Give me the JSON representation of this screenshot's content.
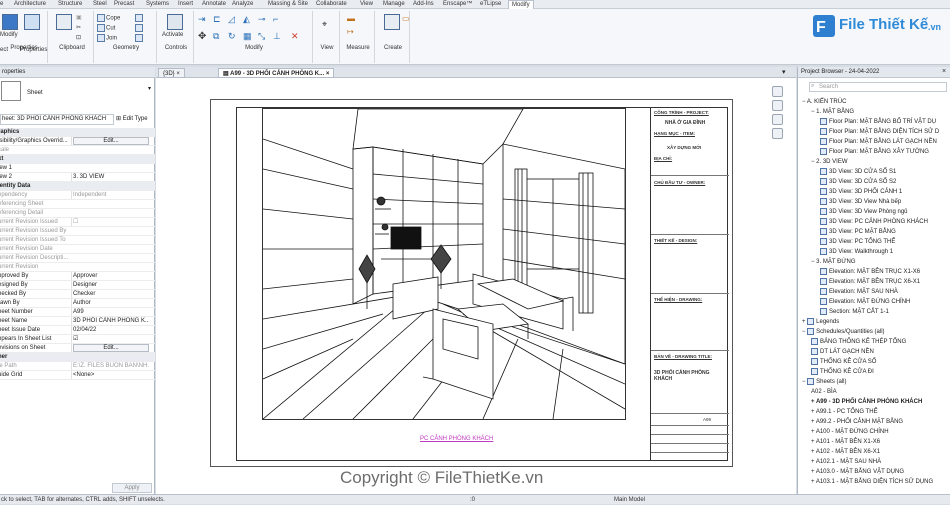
{
  "ribbon": {
    "tabs": [
      "e",
      "Architecture",
      "Structure",
      "Steel",
      "Precast",
      "Systems",
      "Insert",
      "Annotate",
      "Analyze",
      "Massing & Site",
      "Collaborate",
      "View",
      "Manage",
      "Add-Ins",
      "Enscape™",
      "eTLipse",
      "Modify"
    ],
    "active_tab": "Modify",
    "buttons": {
      "modify": "Modify",
      "select": "ect",
      "properties": "Properties",
      "cope": "Cope",
      "cut": "Cut",
      "join": "Join",
      "activate": "Activate"
    },
    "panels": [
      "Properties",
      "Clipboard",
      "Geometry",
      "Controls",
      "Modify",
      "View",
      "Measure",
      "Create"
    ]
  },
  "logo": {
    "text": "File Thiết Kế",
    "suffix": ".vn"
  },
  "document_tabs": [
    {
      "label": "{3D}",
      "active": false
    },
    {
      "label": "A99 - 3D PHỐI CẢNH PHÒNG K...",
      "active": true
    }
  ],
  "properties": {
    "title": "roperties",
    "type_name": "Sheet",
    "selector": "heet: 3D PHỐI CẢNH PHÒNG KHÁCH",
    "edit_type": "Edit Type",
    "rows": [
      {
        "k": "raphics",
        "v": "",
        "group": true
      },
      {
        "k": "isibility/Graphics Overrid...",
        "v": "Edit...",
        "btn": true
      },
      {
        "k": "cale",
        "v": "",
        "dim": true
      },
      {
        "k": "xt",
        "v": "",
        "group": true
      },
      {
        "k": "iew 1",
        "v": ""
      },
      {
        "k": "iew 2",
        "v": "3. 3D VIEW"
      },
      {
        "k": "lentity Data",
        "v": "",
        "group": true
      },
      {
        "k": "ependency",
        "v": "Independent",
        "dim": true
      },
      {
        "k": "eferencing Sheet",
        "v": "",
        "dim": true
      },
      {
        "k": "eferencing Detail",
        "v": "",
        "dim": true
      },
      {
        "k": "urrent Revision Issued",
        "v": "☐",
        "dim": true
      },
      {
        "k": "urrent Revision Issued By",
        "v": "",
        "dim": true
      },
      {
        "k": "urrent Revision Issued To",
        "v": "",
        "dim": true
      },
      {
        "k": "urrent Revision Date",
        "v": "",
        "dim": true
      },
      {
        "k": "urrent Revision Descripti...",
        "v": "",
        "dim": true
      },
      {
        "k": "urrent Revision",
        "v": "",
        "dim": true
      },
      {
        "k": "pproved By",
        "v": "Approver"
      },
      {
        "k": "esigned By",
        "v": "Designer"
      },
      {
        "k": "hecked By",
        "v": "Checker"
      },
      {
        "k": "rawn By",
        "v": "Author"
      },
      {
        "k": "heet Number",
        "v": "A99"
      },
      {
        "k": "heet Name",
        "v": "3D PHỐI CẢNH PHÒNG K..."
      },
      {
        "k": "heet Issue Date",
        "v": "02/04/22"
      },
      {
        "k": "ppears In Sheet List",
        "v": "☑"
      },
      {
        "k": "evisions on Sheet",
        "v": "Edit...",
        "btn": true
      },
      {
        "k": "her",
        "v": "",
        "group": true
      },
      {
        "k": "le Path",
        "v": "E:\\Z. FILES BUON BAN\\NH...",
        "dim": true
      },
      {
        "k": "uide Grid",
        "v": "<None>"
      }
    ],
    "apply": "Apply"
  },
  "titleblock": {
    "project_label": "CÔNG TRÌNH - PROJECT:",
    "project": "NHÀ Ở GIA ĐÌNH",
    "item_label": "HẠNG MỤC - ITEM:",
    "item": "XÂY DỰNG MỚI",
    "address_label": "ĐỊA CHỈ:",
    "owner_label": "CHỦ ĐẦU TƯ - OWNER:",
    "design_label": "THIẾT KẾ - DESIGN:",
    "drawing_label": "THỂ HIỆN - DRAWING:",
    "title_label": "BẢN VẼ - DRAWING TITLE:",
    "title": "3D PHỐI CẢNH PHÒNG KHÁCH",
    "sheet_no": "A99"
  },
  "viewport_label": "PC CẢNH PHÒNG KHÁCH",
  "project_browser": {
    "title": "Project Browser - 24-04-2022",
    "search_placeholder": "Search",
    "items": [
      {
        "t": "A. KIẾN TRÚC",
        "lvl": 0,
        "ico": false,
        "exp": "−"
      },
      {
        "t": "1. MẶT BẰNG",
        "lvl": 1,
        "ico": false,
        "exp": "−"
      },
      {
        "t": "Floor Plan: MẶT BẰNG BỐ TRÍ VẬT DỤ",
        "lvl": 2,
        "ico": true
      },
      {
        "t": "Floor Plan: MẶT BẰNG DIỆN TÍCH SỬ D",
        "lvl": 2,
        "ico": true
      },
      {
        "t": "Floor Plan: MẶT BẰNG LÁT GẠCH NỀN",
        "lvl": 2,
        "ico": true
      },
      {
        "t": "Floor Plan: MẶT BẰNG XÂY TƯỜNG",
        "lvl": 2,
        "ico": true
      },
      {
        "t": "2. 3D VIEW",
        "lvl": 1,
        "ico": false,
        "exp": "−"
      },
      {
        "t": "3D View: 3D CỬA SỔ S1",
        "lvl": 2,
        "ico": true
      },
      {
        "t": "3D View: 3D CỬA SỔ S2",
        "lvl": 2,
        "ico": true
      },
      {
        "t": "3D View: 3D PHỐI CẢNH 1",
        "lvl": 2,
        "ico": true
      },
      {
        "t": "3D View: 3D View Nhà bếp",
        "lvl": 2,
        "ico": true
      },
      {
        "t": "3D View: 3D View Phòng ngủ",
        "lvl": 2,
        "ico": true
      },
      {
        "t": "3D View: PC CẢNH PHÒNG KHÁCH",
        "lvl": 2,
        "ico": true
      },
      {
        "t": "3D View: PC MẶT BẰNG",
        "lvl": 2,
        "ico": true
      },
      {
        "t": "3D View: PC TỔNG THỂ",
        "lvl": 2,
        "ico": true
      },
      {
        "t": "3D View: Walkthrough 1",
        "lvl": 2,
        "ico": true
      },
      {
        "t": "3. MẶT ĐỨNG",
        "lvl": 1,
        "ico": false,
        "exp": "−"
      },
      {
        "t": "Elevation: MẶT BÊN TRỤC X1-X6",
        "lvl": 2,
        "ico": true
      },
      {
        "t": "Elevation: MẶT BÊN TRỤC X6-X1",
        "lvl": 2,
        "ico": true
      },
      {
        "t": "Elevation: MẶT SAU NHÀ",
        "lvl": 2,
        "ico": true
      },
      {
        "t": "Elevation: MẶT ĐỨNG CHÍNH",
        "lvl": 2,
        "ico": true
      },
      {
        "t": "Section: MẶT CẮT 1-1",
        "lvl": 2,
        "ico": true
      },
      {
        "t": "Legends",
        "lvl": 0,
        "ico": true,
        "exp": "+"
      },
      {
        "t": "Schedules/Quantities (all)",
        "lvl": 0,
        "ico": true,
        "exp": "−"
      },
      {
        "t": "BẢNG THỐNG KÊ THÉP TỔNG",
        "lvl": 1,
        "ico": true
      },
      {
        "t": "DT LÁT GẠCH NỀN",
        "lvl": 1,
        "ico": true
      },
      {
        "t": "THỐNG KÊ CỬA SỔ",
        "lvl": 1,
        "ico": true
      },
      {
        "t": "THỐNG KÊ CỬA ĐI",
        "lvl": 1,
        "ico": true
      },
      {
        "t": "Sheets (all)",
        "lvl": 0,
        "ico": true,
        "exp": "−"
      },
      {
        "t": "A02 - BÌA",
        "lvl": 1,
        "ico": false
      },
      {
        "t": "A99 - 3D PHỐI CẢNH PHÒNG KHÁCH",
        "lvl": 1,
        "ico": false,
        "bold": true,
        "exp": "+"
      },
      {
        "t": "A99.1 - PC TỔNG THỂ",
        "lvl": 1,
        "ico": false,
        "exp": "+"
      },
      {
        "t": "A99.2 - PHỐI CẢNH MẶT BẰNG",
        "lvl": 1,
        "ico": false,
        "exp": "+"
      },
      {
        "t": "A100 - MẶT ĐỨNG CHÍNH",
        "lvl": 1,
        "ico": false,
        "exp": "+"
      },
      {
        "t": "A101 - MẶT BÊN X1-X6",
        "lvl": 1,
        "ico": false,
        "exp": "+"
      },
      {
        "t": "A102 - MẶT BÊN X6-X1",
        "lvl": 1,
        "ico": false,
        "exp": "+"
      },
      {
        "t": "A102.1 - MẶT SAU NHÀ",
        "lvl": 1,
        "ico": false,
        "exp": "+"
      },
      {
        "t": "A103.0 - MẶT BẰNG VẬT DỤNG",
        "lvl": 1,
        "ico": false,
        "exp": "+"
      },
      {
        "t": "A103.1 - MẶT BẰNG DIỆN TÍCH SỬ DỤNG",
        "lvl": 1,
        "ico": false,
        "exp": "+"
      }
    ]
  },
  "statusbar": {
    "hint": "ck to select, TAB for alternates, CTRL adds, SHIFT unselects.",
    "zero": ":0",
    "model": "Main Model"
  },
  "watermark": "Copyright © FileThietKe.vn"
}
